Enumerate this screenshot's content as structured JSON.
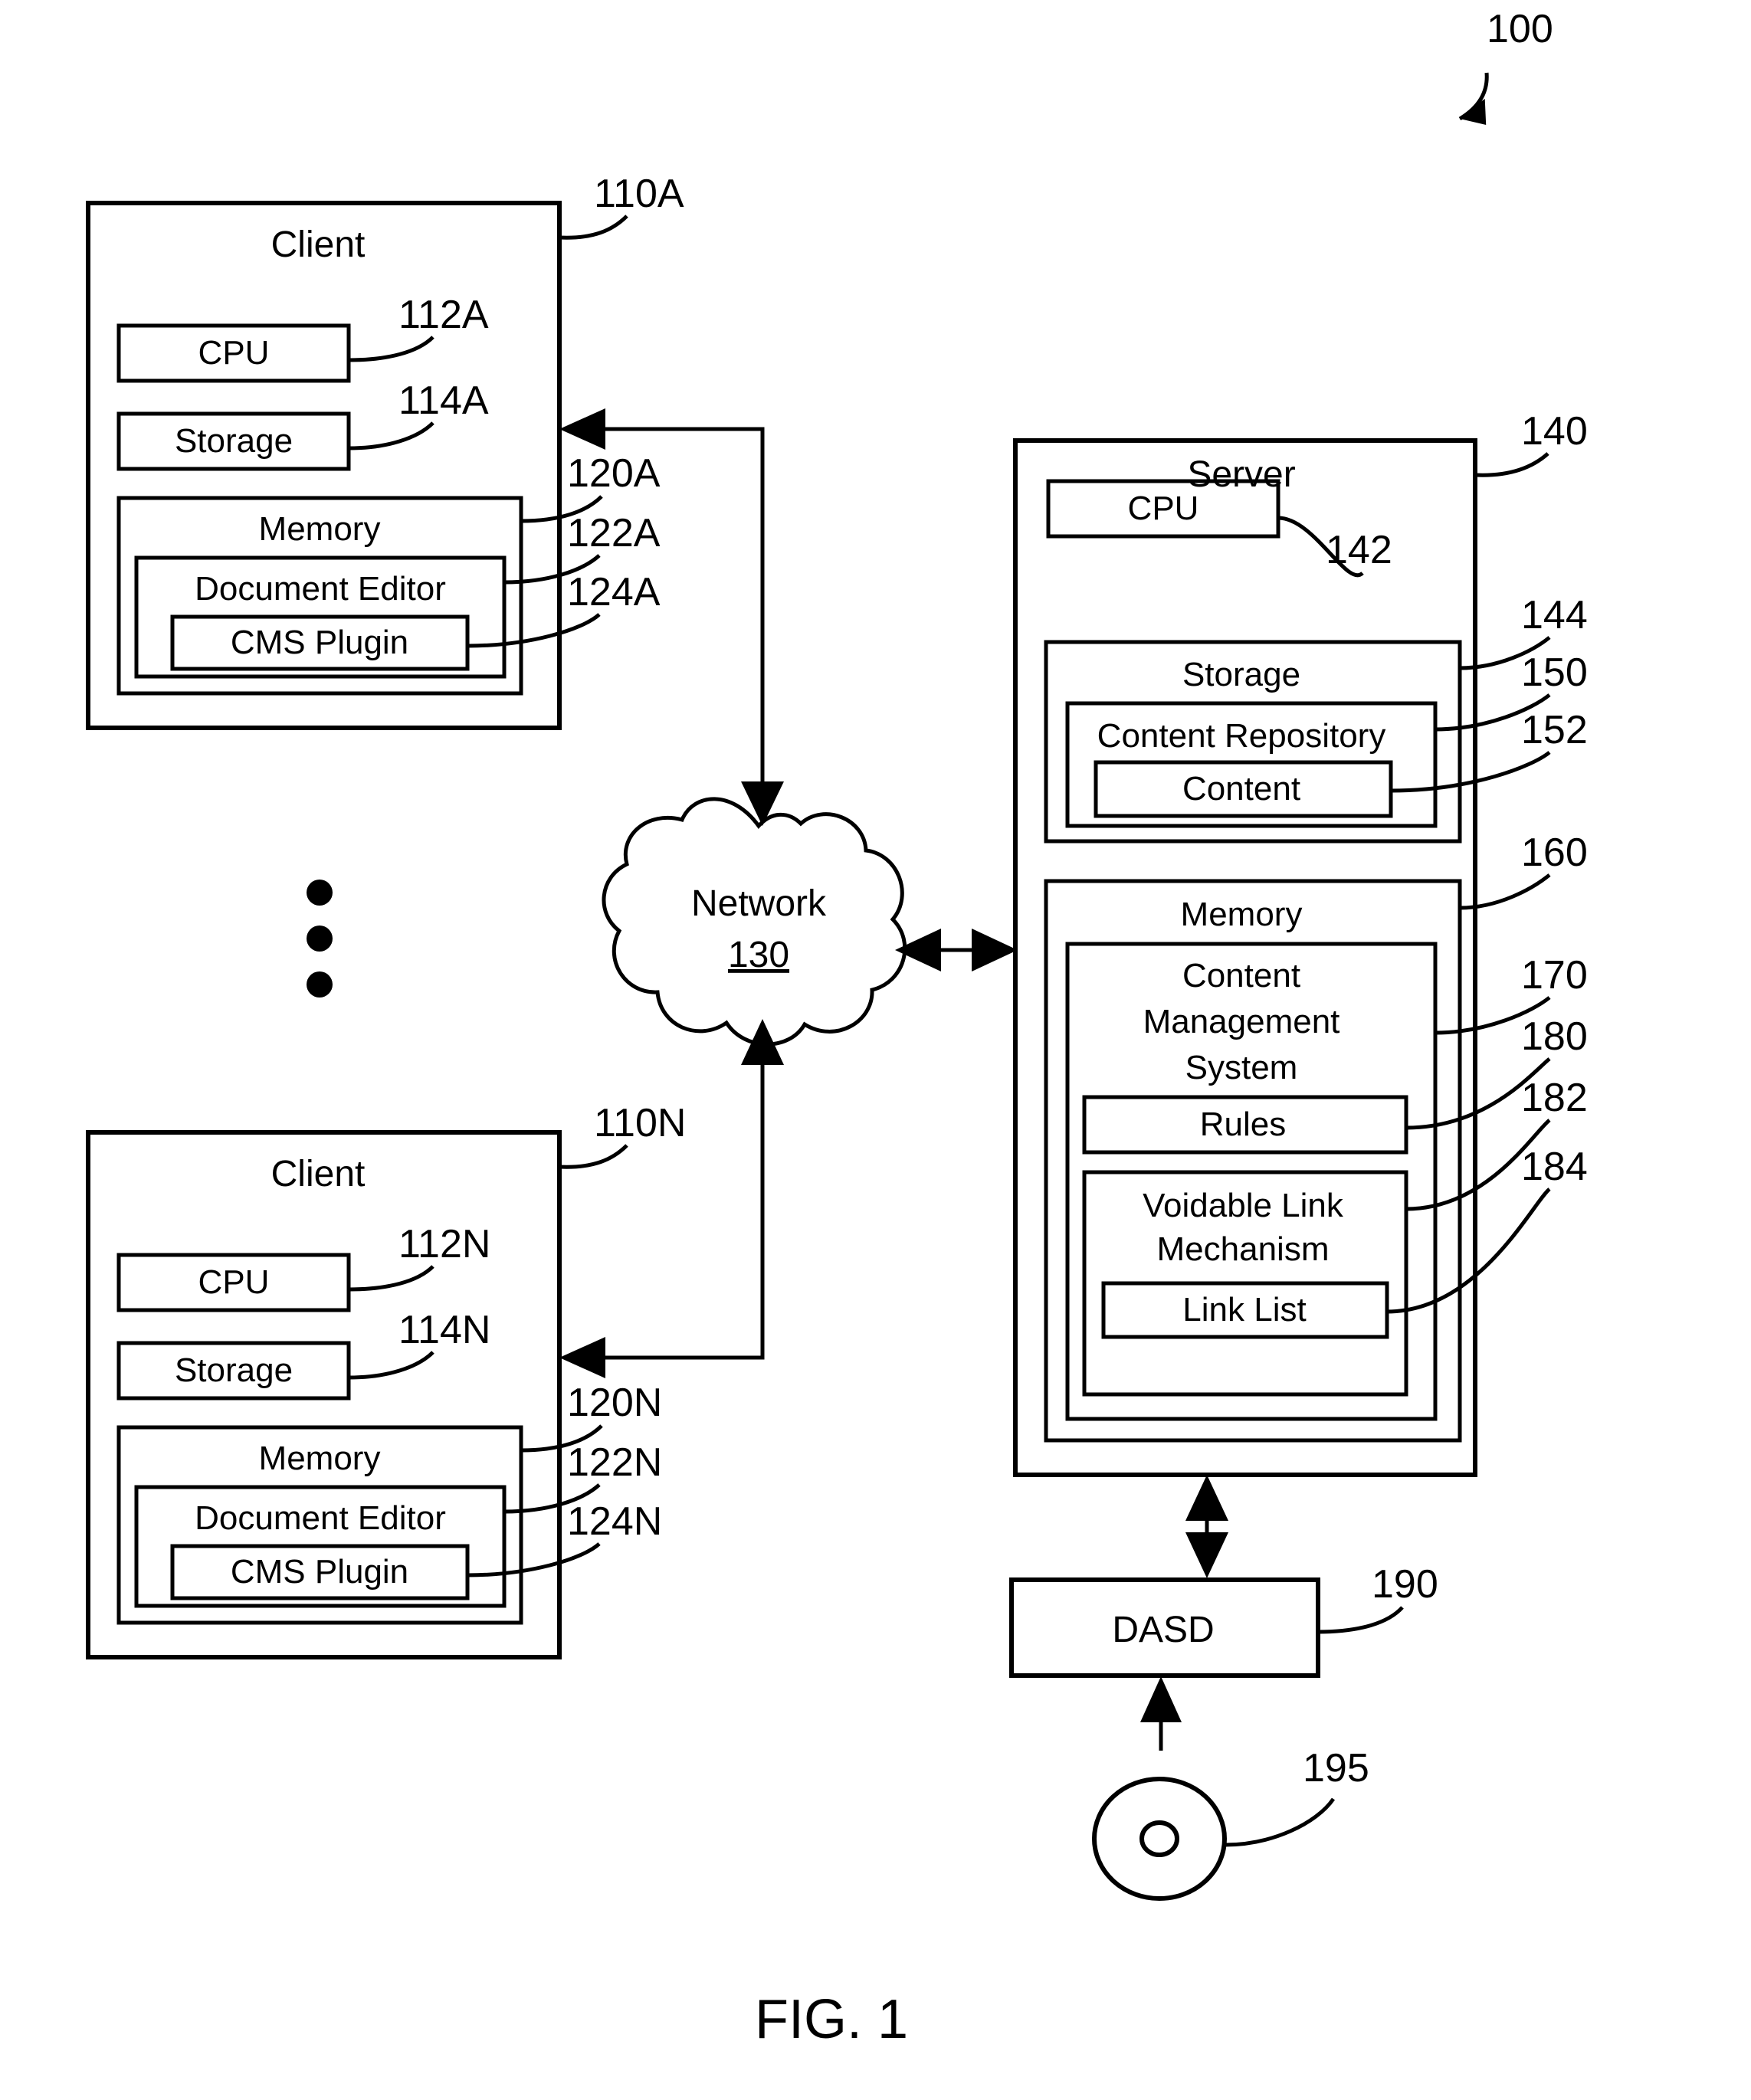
{
  "figure": {
    "caption": "FIG. 1",
    "system_ref": "100"
  },
  "client_a": {
    "title": "Client",
    "ref": "110A",
    "cpu": {
      "label": "CPU",
      "ref": "112A"
    },
    "storage": {
      "label": "Storage",
      "ref": "114A"
    },
    "memory": {
      "label": "Memory",
      "ref": "120A"
    },
    "document_editor": {
      "label": "Document Editor",
      "ref": "122A"
    },
    "cms_plugin": {
      "label": "CMS Plugin",
      "ref": "124A"
    }
  },
  "client_n": {
    "title": "Client",
    "ref": "110N",
    "cpu": {
      "label": "CPU",
      "ref": "112N"
    },
    "storage": {
      "label": "Storage",
      "ref": "114N"
    },
    "memory": {
      "label": "Memory",
      "ref": "120N"
    },
    "document_editor": {
      "label": "Document Editor",
      "ref": "122N"
    },
    "cms_plugin": {
      "label": "CMS Plugin",
      "ref": "124N"
    }
  },
  "network": {
    "label": "Network",
    "ref": "130"
  },
  "server": {
    "title": "Server",
    "ref": "140",
    "cpu": {
      "label": "CPU",
      "ref": "142"
    },
    "storage": {
      "label": "Storage",
      "ref": "144"
    },
    "content_repository": {
      "label": "Content Repository",
      "ref": "150"
    },
    "content": {
      "label": "Content",
      "ref": "152"
    },
    "memory": {
      "label": "Memory",
      "ref": "160"
    },
    "cms": {
      "line1": "Content",
      "line2": "Management",
      "line3": "System",
      "ref": "170"
    },
    "rules": {
      "label": "Rules",
      "ref": "180"
    },
    "voidable_link_mechanism": {
      "line1": "Voidable Link",
      "line2": "Mechanism",
      "ref": "182"
    },
    "link_list": {
      "label": "Link List",
      "ref": "184"
    }
  },
  "dasd": {
    "label": "DASD",
    "ref": "190"
  },
  "media": {
    "ref": "195"
  },
  "colors": {
    "stroke": "#000000",
    "background": "#ffffff"
  }
}
